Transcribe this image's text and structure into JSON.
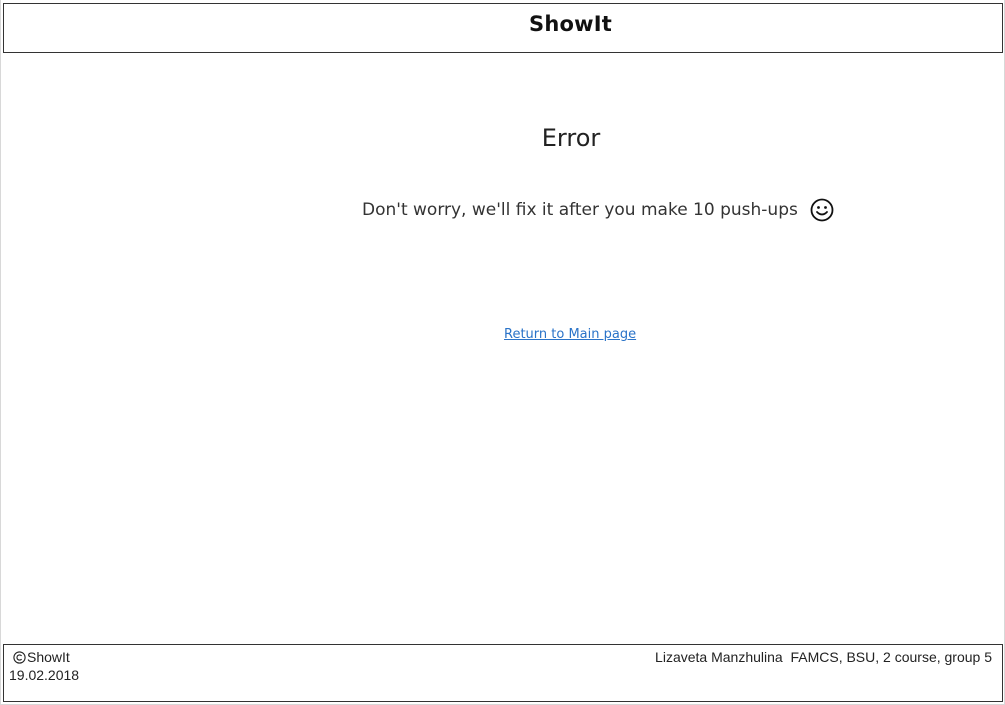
{
  "header": {
    "brand": "ShowIt"
  },
  "main": {
    "title": "Error",
    "message": "Don't worry, we'll fix it after you make 10 push-ups",
    "message_icon": "smile-icon",
    "return_link": "Return to Main page"
  },
  "footer": {
    "copyright_icon": "copyright-icon",
    "copyright_text": "ShowIt",
    "date": "19.02.2018",
    "author": "Lizaveta Manzhulina  FAMCS, BSU, 2 course, group 5"
  },
  "colors": {
    "link": "#2a73c8",
    "border": "#333333",
    "text": "#222222"
  }
}
